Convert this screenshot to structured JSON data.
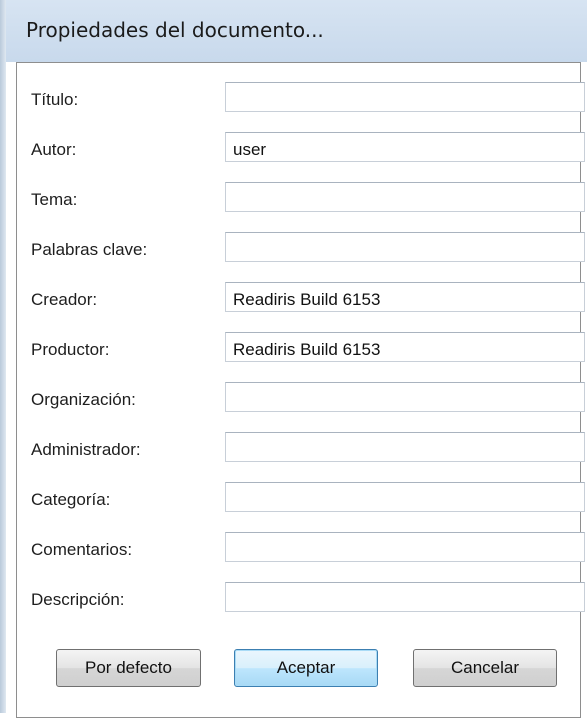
{
  "dialog": {
    "title": "Propiedades del documento..."
  },
  "fields": [
    {
      "label": "Título:",
      "value": ""
    },
    {
      "label": "Autor:",
      "value": "user"
    },
    {
      "label": "Tema:",
      "value": ""
    },
    {
      "label": "Palabras clave:",
      "value": ""
    },
    {
      "label": "Creador:",
      "value": "Readiris Build 6153"
    },
    {
      "label": "Productor:",
      "value": "Readiris Build 6153"
    },
    {
      "label": "Organización:",
      "value": ""
    },
    {
      "label": "Administrador:",
      "value": ""
    },
    {
      "label": "Categoría:",
      "value": ""
    },
    {
      "label": "Comentarios:",
      "value": ""
    },
    {
      "label": "Descripción:",
      "value": ""
    }
  ],
  "buttons": {
    "defaults_label": "Por defecto",
    "ok_label": "Aceptar",
    "cancel_label": "Cancelar"
  },
  "colors": {
    "titlebar": "#cfdfef",
    "default_button_border": "#3c7fb1"
  }
}
